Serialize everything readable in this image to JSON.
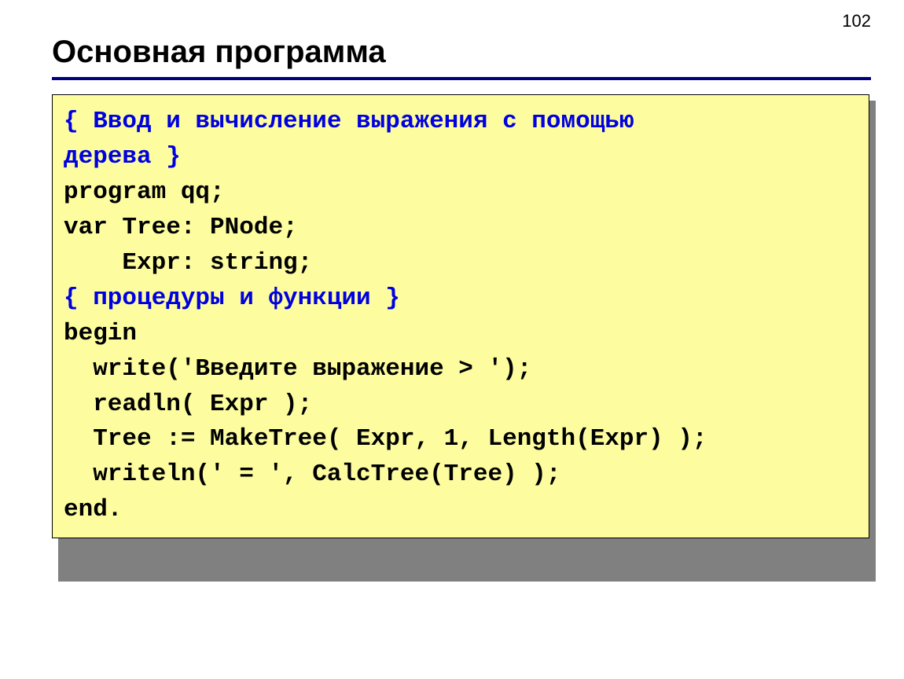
{
  "page_number": "102",
  "heading": "Основная программа",
  "code": {
    "comment1a": "{ Ввод и вычисление выражения с помощью",
    "comment1b": "дерева }",
    "l1": "program qq;",
    "l2": "var Tree: PNode;",
    "l3": "    Expr: string;",
    "comment2": "{ процедуры и функции }",
    "l4": "begin",
    "l5": "  write('Введите выражение > ');",
    "l6": "  readln( Expr );",
    "l7": "  Tree := MakeTree( Expr, 1, Length(Expr) );",
    "l8": "  writeln(' = ', CalcTree(Tree) );",
    "l9": "end."
  }
}
